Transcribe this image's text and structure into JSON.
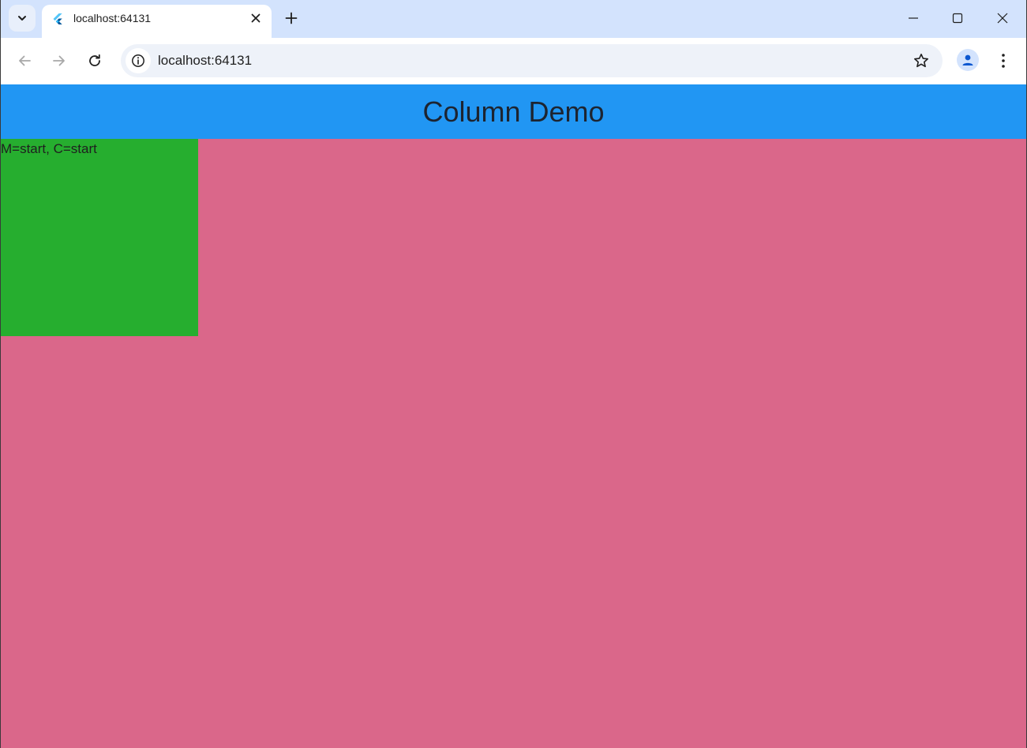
{
  "browser": {
    "tab": {
      "title": "localhost:64131"
    },
    "omnibox": {
      "url": "localhost:64131"
    },
    "icons": {
      "tab_search": "chevron-down-icon",
      "favicon": "flutter-icon",
      "tab_close": "close-icon",
      "new_tab": "plus-icon",
      "minimize": "minimize-icon",
      "maximize": "maximize-icon",
      "close_window": "close-icon",
      "back": "arrow-left-icon",
      "forward": "arrow-right-icon",
      "reload": "reload-icon",
      "site_info": "info-icon",
      "bookmark": "star-icon",
      "profile": "person-icon",
      "menu": "more-vert-icon"
    }
  },
  "app": {
    "appbar": {
      "title": "Column Demo"
    },
    "box": {
      "label": "M=start, C=start"
    }
  },
  "colors": {
    "tabstrip_bg": "#d3e3fd",
    "appbar_bg": "#2196f3",
    "page_bg": "#da678a",
    "box_bg": "#26ae2f"
  }
}
